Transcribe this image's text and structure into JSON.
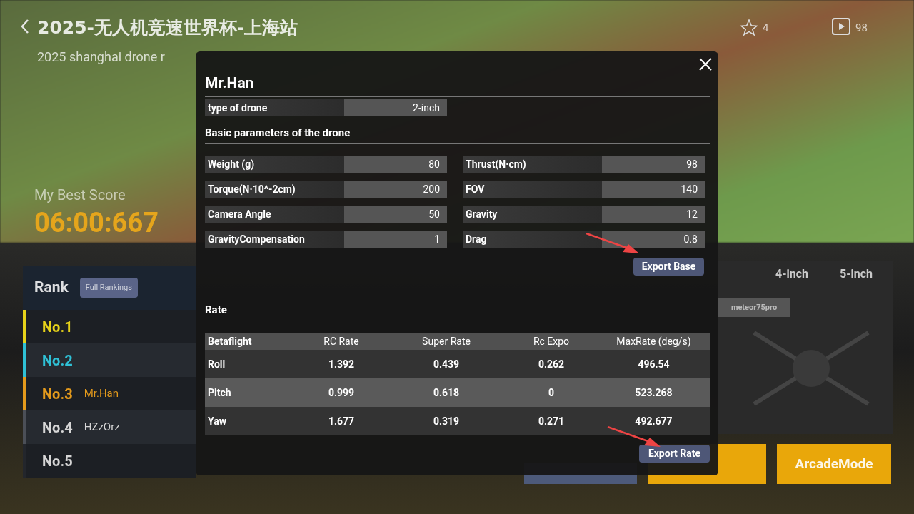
{
  "background": {
    "title": "2025-无人机竞速世界杯-上海站",
    "subtitle": "2025 shanghai drone r",
    "stars_count": "4",
    "videos_count": "98",
    "best_score_label": "My Best Score",
    "best_score": "06:00:667",
    "rank": {
      "title": "Rank",
      "full_rankings": "Full Rankings",
      "entries": [
        {
          "place": "No.1",
          "color": "#e6d21a"
        },
        {
          "place": "No.2",
          "color": "#2fc1d6"
        },
        {
          "place": "No.3",
          "name": "Mr.Han",
          "color": "#e49a1c"
        },
        {
          "place": "No.4",
          "name": "HZzOrz",
          "color": "#4b4f57"
        },
        {
          "place": "No.5",
          "color": "#23262c"
        }
      ]
    },
    "size_tabs": [
      "4-inch",
      "5-inch"
    ],
    "drone_tag": "meteor75pro",
    "mode_button": "ArcadeMode"
  },
  "dialog": {
    "name": "Mr.Han",
    "drone_type": {
      "label": "type of drone",
      "value": "2-inch"
    },
    "basic_title": "Basic parameters of the drone",
    "params": [
      {
        "label": "Weight (g)",
        "value": "80"
      },
      {
        "label": "Thrust(N·cm)",
        "value": "98"
      },
      {
        "label": "Torque(N·10^-2cm)",
        "value": "200"
      },
      {
        "label": "FOV",
        "value": "140"
      },
      {
        "label": "Camera Angle",
        "value": "50"
      },
      {
        "label": "Gravity",
        "value": "12"
      },
      {
        "label": "GravityCompensation",
        "value": "1"
      },
      {
        "label": "Drag",
        "value": "0.8"
      }
    ],
    "export_base": "Export Base",
    "rate_title": "Rate",
    "rate_columns": [
      "Betaflight",
      "RC Rate",
      "Super Rate",
      "Rc Expo",
      "MaxRate (deg/s)"
    ],
    "rate_rows": [
      [
        "Roll",
        "1.392",
        "0.439",
        "0.262",
        "496.54"
      ],
      [
        "Pitch",
        "0.999",
        "0.618",
        "0",
        "523.268"
      ],
      [
        "Yaw",
        "1.677",
        "0.319",
        "0.271",
        "492.677"
      ]
    ],
    "export_rate": "Export Rate"
  }
}
